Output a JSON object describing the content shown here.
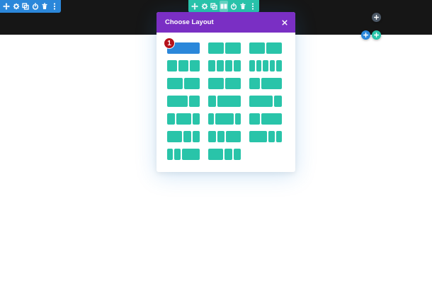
{
  "section_toolbar": {
    "buttons": [
      {
        "name": "move-icon",
        "glyph": "move"
      },
      {
        "name": "gear-icon",
        "glyph": "gear"
      },
      {
        "name": "duplicate-icon",
        "glyph": "duplicate"
      },
      {
        "name": "power-icon",
        "glyph": "power"
      },
      {
        "name": "trash-icon",
        "glyph": "trash"
      },
      {
        "name": "more-icon",
        "glyph": "more"
      }
    ],
    "color": "#2b87da"
  },
  "row_toolbar": {
    "buttons": [
      {
        "name": "move-icon",
        "glyph": "move"
      },
      {
        "name": "gear-icon",
        "glyph": "gear"
      },
      {
        "name": "duplicate-icon",
        "glyph": "duplicate"
      },
      {
        "name": "columns-icon",
        "glyph": "columns",
        "active": true
      },
      {
        "name": "power-icon",
        "glyph": "power"
      },
      {
        "name": "trash-icon",
        "glyph": "trash"
      },
      {
        "name": "more-icon",
        "glyph": "more"
      }
    ],
    "color": "#29c4a9"
  },
  "add_buttons": {
    "add_row_color": "#4c5866",
    "add_section_color": "#2b87da",
    "add_module_color": "#29c4a9"
  },
  "modal": {
    "title": "Choose Layout",
    "header_color": "#7a2fc4",
    "close_icon": "close-icon",
    "layouts": [
      {
        "cols": [
          1
        ],
        "selected": true
      },
      {
        "cols": [
          1,
          1
        ]
      },
      {
        "cols": [
          1,
          1
        ]
      },
      {
        "cols": [
          1,
          1,
          1
        ]
      },
      {
        "cols": [
          1,
          1,
          1,
          1
        ]
      },
      {
        "cols": [
          1,
          1,
          1,
          1,
          1
        ]
      },
      {
        "cols": [
          1,
          1
        ]
      },
      {
        "cols": [
          1,
          1
        ]
      },
      {
        "cols": [
          1,
          2
        ]
      },
      {
        "cols": [
          2,
          1
        ]
      },
      {
        "cols": [
          1,
          3
        ]
      },
      {
        "cols": [
          3,
          1
        ]
      },
      {
        "cols": [
          1,
          2,
          1
        ]
      },
      {
        "cols": [
          1,
          3,
          1
        ]
      },
      {
        "cols": [
          1,
          2
        ]
      },
      {
        "cols": [
          2,
          1,
          1
        ]
      },
      {
        "cols": [
          1,
          1,
          2
        ]
      },
      {
        "cols": [
          3,
          1,
          1
        ]
      },
      {
        "cols": [
          1,
          1,
          3
        ]
      },
      {
        "cols": [
          2,
          1,
          1
        ]
      }
    ],
    "accent_color": "#29c4a9",
    "selected_color": "#2b87da"
  },
  "step_badge": {
    "number": "1",
    "color": "#b5121b"
  }
}
